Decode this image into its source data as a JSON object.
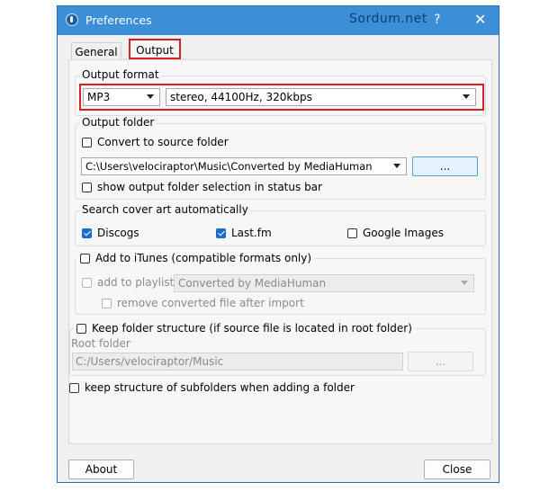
{
  "window": {
    "title": "Preferences",
    "watermark": "Sordum.net",
    "help_glyph": "?",
    "close_glyph": "✕"
  },
  "tabs": [
    {
      "label": "General",
      "selected": false
    },
    {
      "label": "Output",
      "selected": true
    }
  ],
  "output_format": {
    "label": "Output format",
    "format_value": "MP3",
    "quality_value": "stereo, 44100Hz, 320kbps"
  },
  "output_folder": {
    "label": "Output folder",
    "convert_to_source_label": "Convert to source folder",
    "convert_to_source_checked": false,
    "path_value": "C:\\Users\\velociraptor\\Music\\Converted by MediaHuman",
    "browse_label": "...",
    "show_in_status_bar_label": "show output folder selection in status bar",
    "show_in_status_bar_checked": false
  },
  "cover_art": {
    "label": "Search cover art automatically",
    "discogs_label": "Discogs",
    "discogs_checked": true,
    "lastfm_label": "Last.fm",
    "lastfm_checked": true,
    "google_label": "Google Images",
    "google_checked": false
  },
  "itunes": {
    "label": "Add to iTunes (compatible formats only)",
    "checked": false,
    "playlist_label": "add to playlist:",
    "playlist_value": "Converted by MediaHuman",
    "remove_label": "remove converted file after import"
  },
  "structure": {
    "label": "Keep folder structure (if source file is located in root folder)",
    "checked": false,
    "root_label": "Root folder",
    "root_value": "C:/Users/velociraptor/Music",
    "browse_label": "...",
    "subfolders_label": "keep structure of subfolders when adding a folder"
  },
  "footer": {
    "about_label": "About",
    "close_label": "Close"
  },
  "colors": {
    "titlebar": "#3c8fd6",
    "highlight": "#d71f26",
    "checkbox_on": "#1a6dc9"
  }
}
